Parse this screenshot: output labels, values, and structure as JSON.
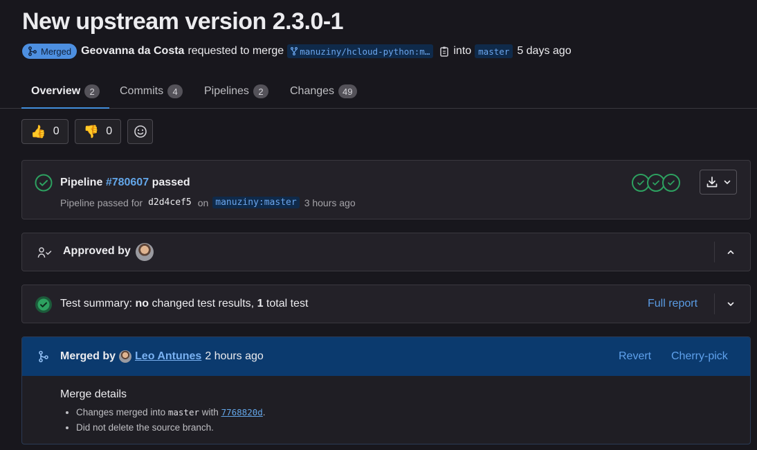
{
  "title": "New upstream version 2.3.0-1",
  "meta": {
    "status_badge": "Merged",
    "author": "Geovanna da Costa",
    "action_text": "requested to merge",
    "source_branch": "manuziny/hcloud-python:m…",
    "into_text": "into",
    "target_branch": "master",
    "time_ago": "5 days ago"
  },
  "tabs": [
    {
      "label": "Overview",
      "count": "2"
    },
    {
      "label": "Commits",
      "count": "4"
    },
    {
      "label": "Pipelines",
      "count": "2"
    },
    {
      "label": "Changes",
      "count": "49"
    }
  ],
  "reactions": {
    "thumbs_up": "👍",
    "thumbs_up_count": "0",
    "thumbs_down": "👎",
    "thumbs_down_count": "0"
  },
  "pipeline": {
    "prefix": "Pipeline",
    "id": "#780607",
    "status": "passed",
    "sub_prefix": "Pipeline passed for",
    "sha": "d2d4cef5",
    "on_text": "on",
    "branch": "manuziny:master",
    "time_ago": "3 hours ago"
  },
  "approvals": {
    "label": "Approved by"
  },
  "test_summary": {
    "prefix": "Test summary:",
    "no": "no",
    "middle": "changed test results,",
    "count": "1",
    "suffix": "total test",
    "full_report": "Full report"
  },
  "merged": {
    "label": "Merged by",
    "user": "Leo Antunes",
    "time_ago": "2 hours ago",
    "revert": "Revert",
    "cherry_pick": "Cherry-pick",
    "details_title": "Merge details",
    "line1_prefix": "Changes merged into",
    "line1_branch": "master",
    "line1_with": "with",
    "line1_commit": "7768820d",
    "line1_end": ".",
    "line2": "Did not delete the source branch."
  },
  "colors": {
    "background": "#18171d",
    "accent": "#428fdc",
    "success": "#2da160",
    "merged_banner": "#0b3a6e"
  }
}
